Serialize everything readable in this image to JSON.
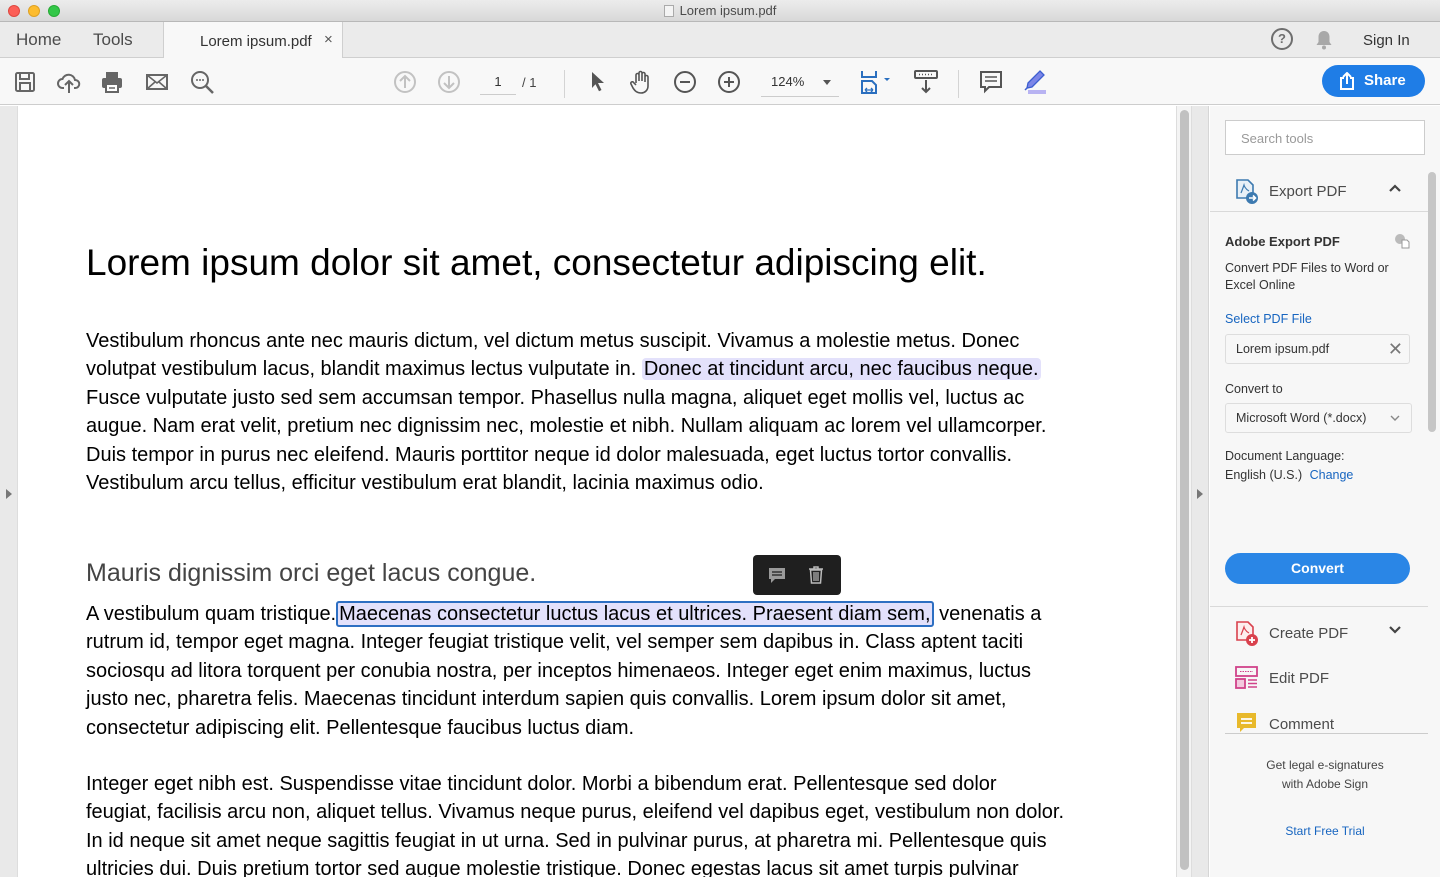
{
  "window": {
    "title": "Lorem ipsum.pdf"
  },
  "tabs": {
    "home": "Home",
    "tools": "Tools",
    "document": "Lorem ipsum.pdf",
    "close": "×"
  },
  "header": {
    "help": "?",
    "sign_in": "Sign In"
  },
  "toolbar": {
    "icons": [
      "save-icon",
      "upload-cloud-icon",
      "print-icon",
      "email-icon",
      "search-icon",
      "previous-page-icon",
      "next-page-icon",
      "select-cursor-icon",
      "hand-icon",
      "zoom-out-icon",
      "zoom-in-icon",
      "fit-page-icon",
      "scroll-mode-icon",
      "comment-icon",
      "highlight-icon"
    ],
    "page_current": "1",
    "page_total": "/ 1",
    "zoom_level": "124%",
    "share_label": "Share"
  },
  "document": {
    "title": "Lorem ipsum dolor sit amet, consectetur adipiscing elit.",
    "para1": {
      "lines": [
        "Vestibulum rhoncus ante nec mauris dictum, vel dictum metus suscipit. Vivamus a molestie metus. Donec",
        "volutpat vestibulum lacus, blandit maximus lectus vulputate in. ",
        "Fusce vulputate justo sed sem accumsan tempor. Phasellus nulla magna, aliquet eget mollis vel, luctus ac",
        "augue. Nam erat velit, pretium nec dignissim nec, molestie et nibh. Nullam aliquam ac lorem vel ullamcorper.",
        "Duis tempor in purus nec eleifend. Mauris porttitor neque id dolor malesuada, eget luctus tortor convallis.",
        "Vestibulum arcu tellus, efficitur vestibulum erat blandit, lacinia maximus odio."
      ],
      "highlight": "Donec at tincidunt arcu, nec faucibus neque."
    },
    "heading2": "Mauris dignissim orci eget lacus congue.",
    "para2": {
      "line1_before": "A vestibulum quam tristique.",
      "line1_selected": "Maecenas consectetur luctus lacus et ultrices. Praesent diam sem,",
      "line1_after": " venenatis a",
      "lines": [
        "rutrum id, tempor eget magna. Integer feugiat tristique velit, vel semper sem dapibus in. Class aptent taciti",
        "sociosqu ad litora torquent per conubia nostra, per inceptos himenaeos. Integer eget enim maximus, luctus",
        "justo nec, pharetra felis. Maecenas tincidunt interdum sapien quis convallis. Lorem ipsum dolor sit amet,",
        "consectetur adipiscing elit. Pellentesque faucibus luctus diam."
      ]
    },
    "para3": {
      "lines": [
        "Integer eget nibh est. Suspendisse vitae tincidunt dolor. Morbi a bibendum erat. Pellentesque sed dolor",
        "feugiat, facilisis arcu non, aliquet tellus. Vivamus neque purus, eleifend vel dapibus eget, vestibulum non dolor.",
        "In id neque sit amet neque sagittis feugiat in ut urna. Sed in pulvinar purus, at pharetra mi. Pellentesque quis",
        "ultricies dui. Duis pretium tortor sed augue molestie tristique. Donec egestas lacus sit amet turpis pulvinar"
      ]
    },
    "annotation_popup": {
      "comment_icon": "comment-icon",
      "delete_icon": "trash-icon"
    }
  },
  "panel": {
    "search_placeholder": "Search tools",
    "export": {
      "header": "Export PDF",
      "title": "Adobe Export PDF",
      "description": "Convert PDF Files to Word or Excel Online",
      "select_file_link": "Select PDF File",
      "file_name": "Lorem ipsum.pdf",
      "convert_to_label": "Convert to",
      "convert_to_value": "Microsoft Word (*.docx)",
      "language_label": "Document Language:",
      "language_value": "English (U.S.)",
      "change_link": "Change",
      "convert_button": "Convert"
    },
    "tools": [
      {
        "label": "Create PDF",
        "icon": "create-pdf-icon"
      },
      {
        "label": "Edit PDF",
        "icon": "edit-pdf-icon"
      },
      {
        "label": "Comment",
        "icon": "comment-icon"
      }
    ],
    "promo": {
      "line1": "Get legal e-signatures",
      "line2": "with Adobe Sign",
      "link": "Start Free Trial"
    }
  },
  "colors": {
    "accent": "#1f7de6",
    "highlight": "#e3e1fb",
    "selection_border": "#2d6fc2",
    "link": "#1765c0"
  }
}
